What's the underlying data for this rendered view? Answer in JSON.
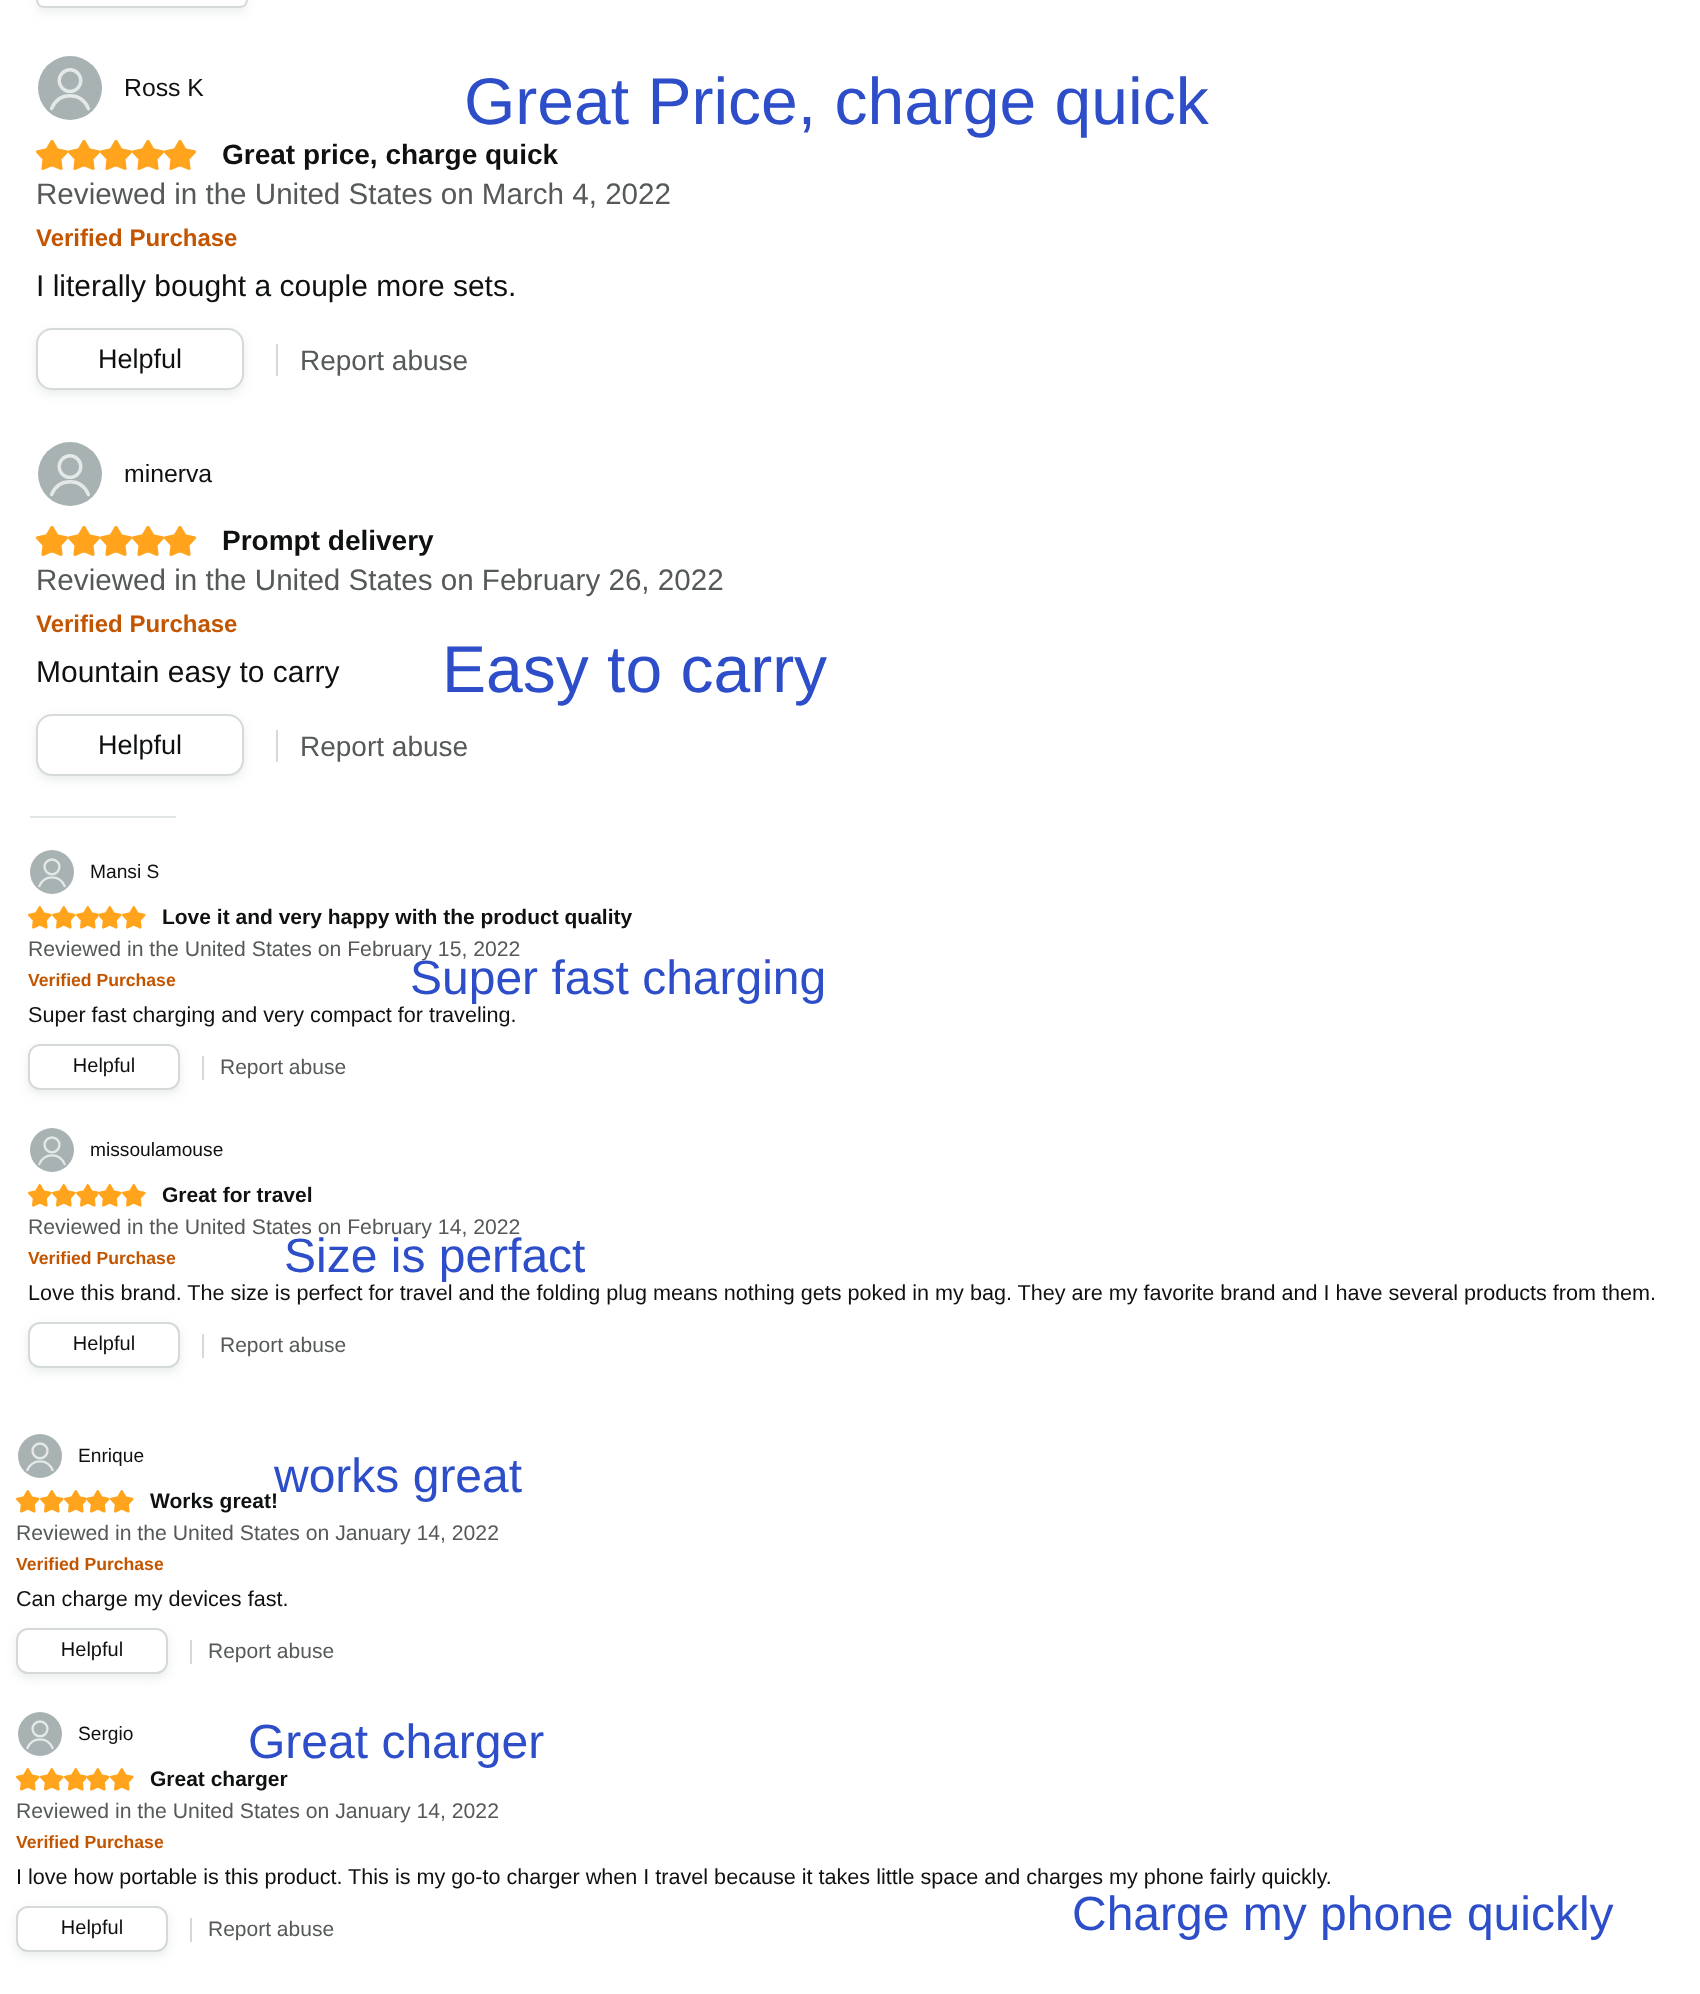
{
  "sections": [
    {
      "reviews": [
        {
          "reviewer": "Ross K",
          "stars": 5,
          "title": "Great price, charge quick",
          "date": "Reviewed in the United States on March 4, 2022",
          "badge": "Verified Purchase",
          "body": "I literally bought a couple more sets.",
          "helpful": "Helpful",
          "report": "Report abuse",
          "callouts": [
            "Great Price, charge quick"
          ]
        },
        {
          "reviewer": "minerva",
          "stars": 5,
          "title": "Prompt delivery",
          "date": "Reviewed in the United States on February 26, 2022",
          "badge": "Verified Purchase",
          "body": "Mountain easy to carry",
          "helpful": "Helpful",
          "report": "Report abuse",
          "callouts": [
            "Easy to carry"
          ]
        }
      ]
    },
    {
      "reviews": [
        {
          "reviewer": "Mansi S",
          "stars": 5,
          "title": "Love it and very happy with the product quality",
          "date": "Reviewed in the United States on February 15, 2022",
          "badge": "Verified Purchase",
          "body": "Super fast charging and very compact for traveling.",
          "helpful": "Helpful",
          "report": "Report abuse",
          "callouts": [
            "Super fast charging"
          ]
        },
        {
          "reviewer": "missoulamouse",
          "stars": 5,
          "title": "Great for travel",
          "date": "Reviewed in the United States on February 14, 2022",
          "badge": "Verified Purchase",
          "body": "Love this brand. The size is perfect for travel and the folding plug means nothing gets poked in my bag. They are my favorite brand and I have several products from them.",
          "helpful": "Helpful",
          "report": "Report abuse",
          "callouts": [
            "Size is perfact"
          ]
        }
      ]
    },
    {
      "reviews": [
        {
          "reviewer": "Enrique",
          "stars": 5,
          "title": "Works great!",
          "date": "Reviewed in the United States on January 14, 2022",
          "badge": "Verified Purchase",
          "body": "Can charge my devices fast.",
          "helpful": "Helpful",
          "report": "Report abuse",
          "callouts": [
            "works great"
          ]
        },
        {
          "reviewer": "Sergio",
          "stars": 5,
          "title": "Great charger",
          "date": "Reviewed in the United States on January 14, 2022",
          "badge": "Verified Purchase",
          "body": "I love how portable is this product. This is my go-to charger when I travel because it takes little space and charges my phone fairly quickly.",
          "helpful": "Helpful",
          "report": "Report abuse",
          "callouts": [
            "Great charger",
            "Charge my phone quickly"
          ]
        }
      ]
    }
  ]
}
